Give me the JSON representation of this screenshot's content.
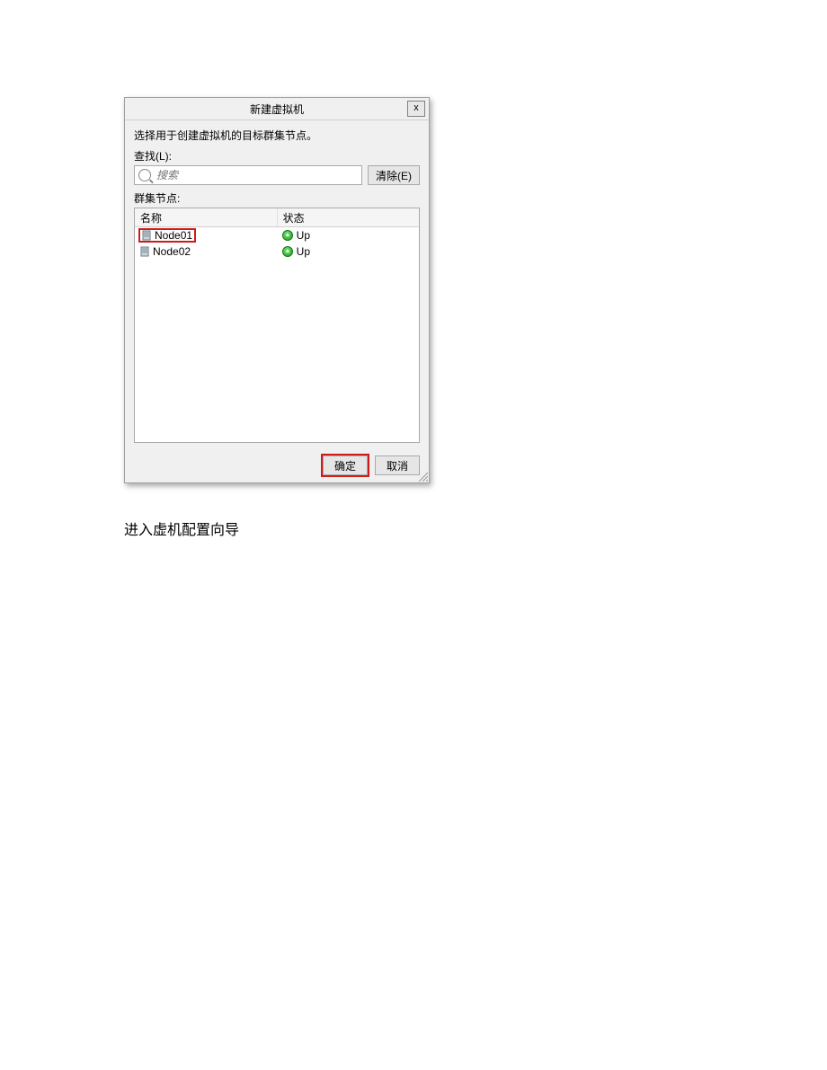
{
  "dialog": {
    "title": "新建虚拟机",
    "close": "x",
    "instruction": "选择用于创建虚拟机的目标群集节点。",
    "search_label": "查找(L):",
    "search_placeholder": "搜索",
    "clear_button": "清除(E)",
    "nodes_label": "群集节点:",
    "columns": {
      "name": "名称",
      "status": "状态"
    },
    "rows": [
      {
        "name": "Node01",
        "status": "Up",
        "highlight": true
      },
      {
        "name": "Node02",
        "status": "Up",
        "highlight": false
      }
    ],
    "buttons": {
      "ok": "确定",
      "cancel": "取消"
    }
  },
  "caption": "进入虚机配置向导"
}
